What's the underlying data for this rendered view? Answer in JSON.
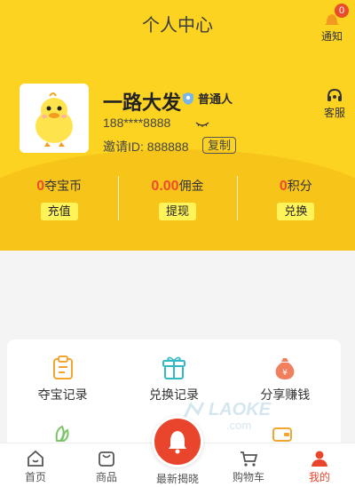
{
  "header": {
    "title": "个人中心",
    "notice_label": "通知",
    "notice_count": "0"
  },
  "profile": {
    "name": "一路大发",
    "level": "普通人",
    "phone": "188****8888",
    "invite_id": "邀请ID: 888888",
    "copy_label": "复制",
    "service_label": "客服"
  },
  "stats": [
    {
      "value": "0",
      "unit": "夺宝币",
      "action": "充值"
    },
    {
      "value": "0.00",
      "unit": "佣金",
      "action": "提现"
    },
    {
      "value": "0",
      "unit": "积分",
      "action": "兑换"
    }
  ],
  "functions": [
    {
      "label": "夺宝记录",
      "icon": "clipboard-icon"
    },
    {
      "label": "兑换记录",
      "icon": "gift-icon"
    },
    {
      "label": "分享赚钱",
      "icon": "money-bag-icon"
    }
  ],
  "tabs": [
    {
      "label": "首页",
      "icon": "home-icon"
    },
    {
      "label": "商品",
      "icon": "bag-icon"
    },
    {
      "label": "最新揭晓",
      "icon": "bell-icon"
    },
    {
      "label": "购物车",
      "icon": "cart-icon"
    },
    {
      "label": "我的",
      "icon": "user-icon"
    }
  ],
  "colors": {
    "brand_yellow": "#fdd321",
    "accent_red": "#e9452d",
    "highlight_yellow": "#fff35a"
  }
}
